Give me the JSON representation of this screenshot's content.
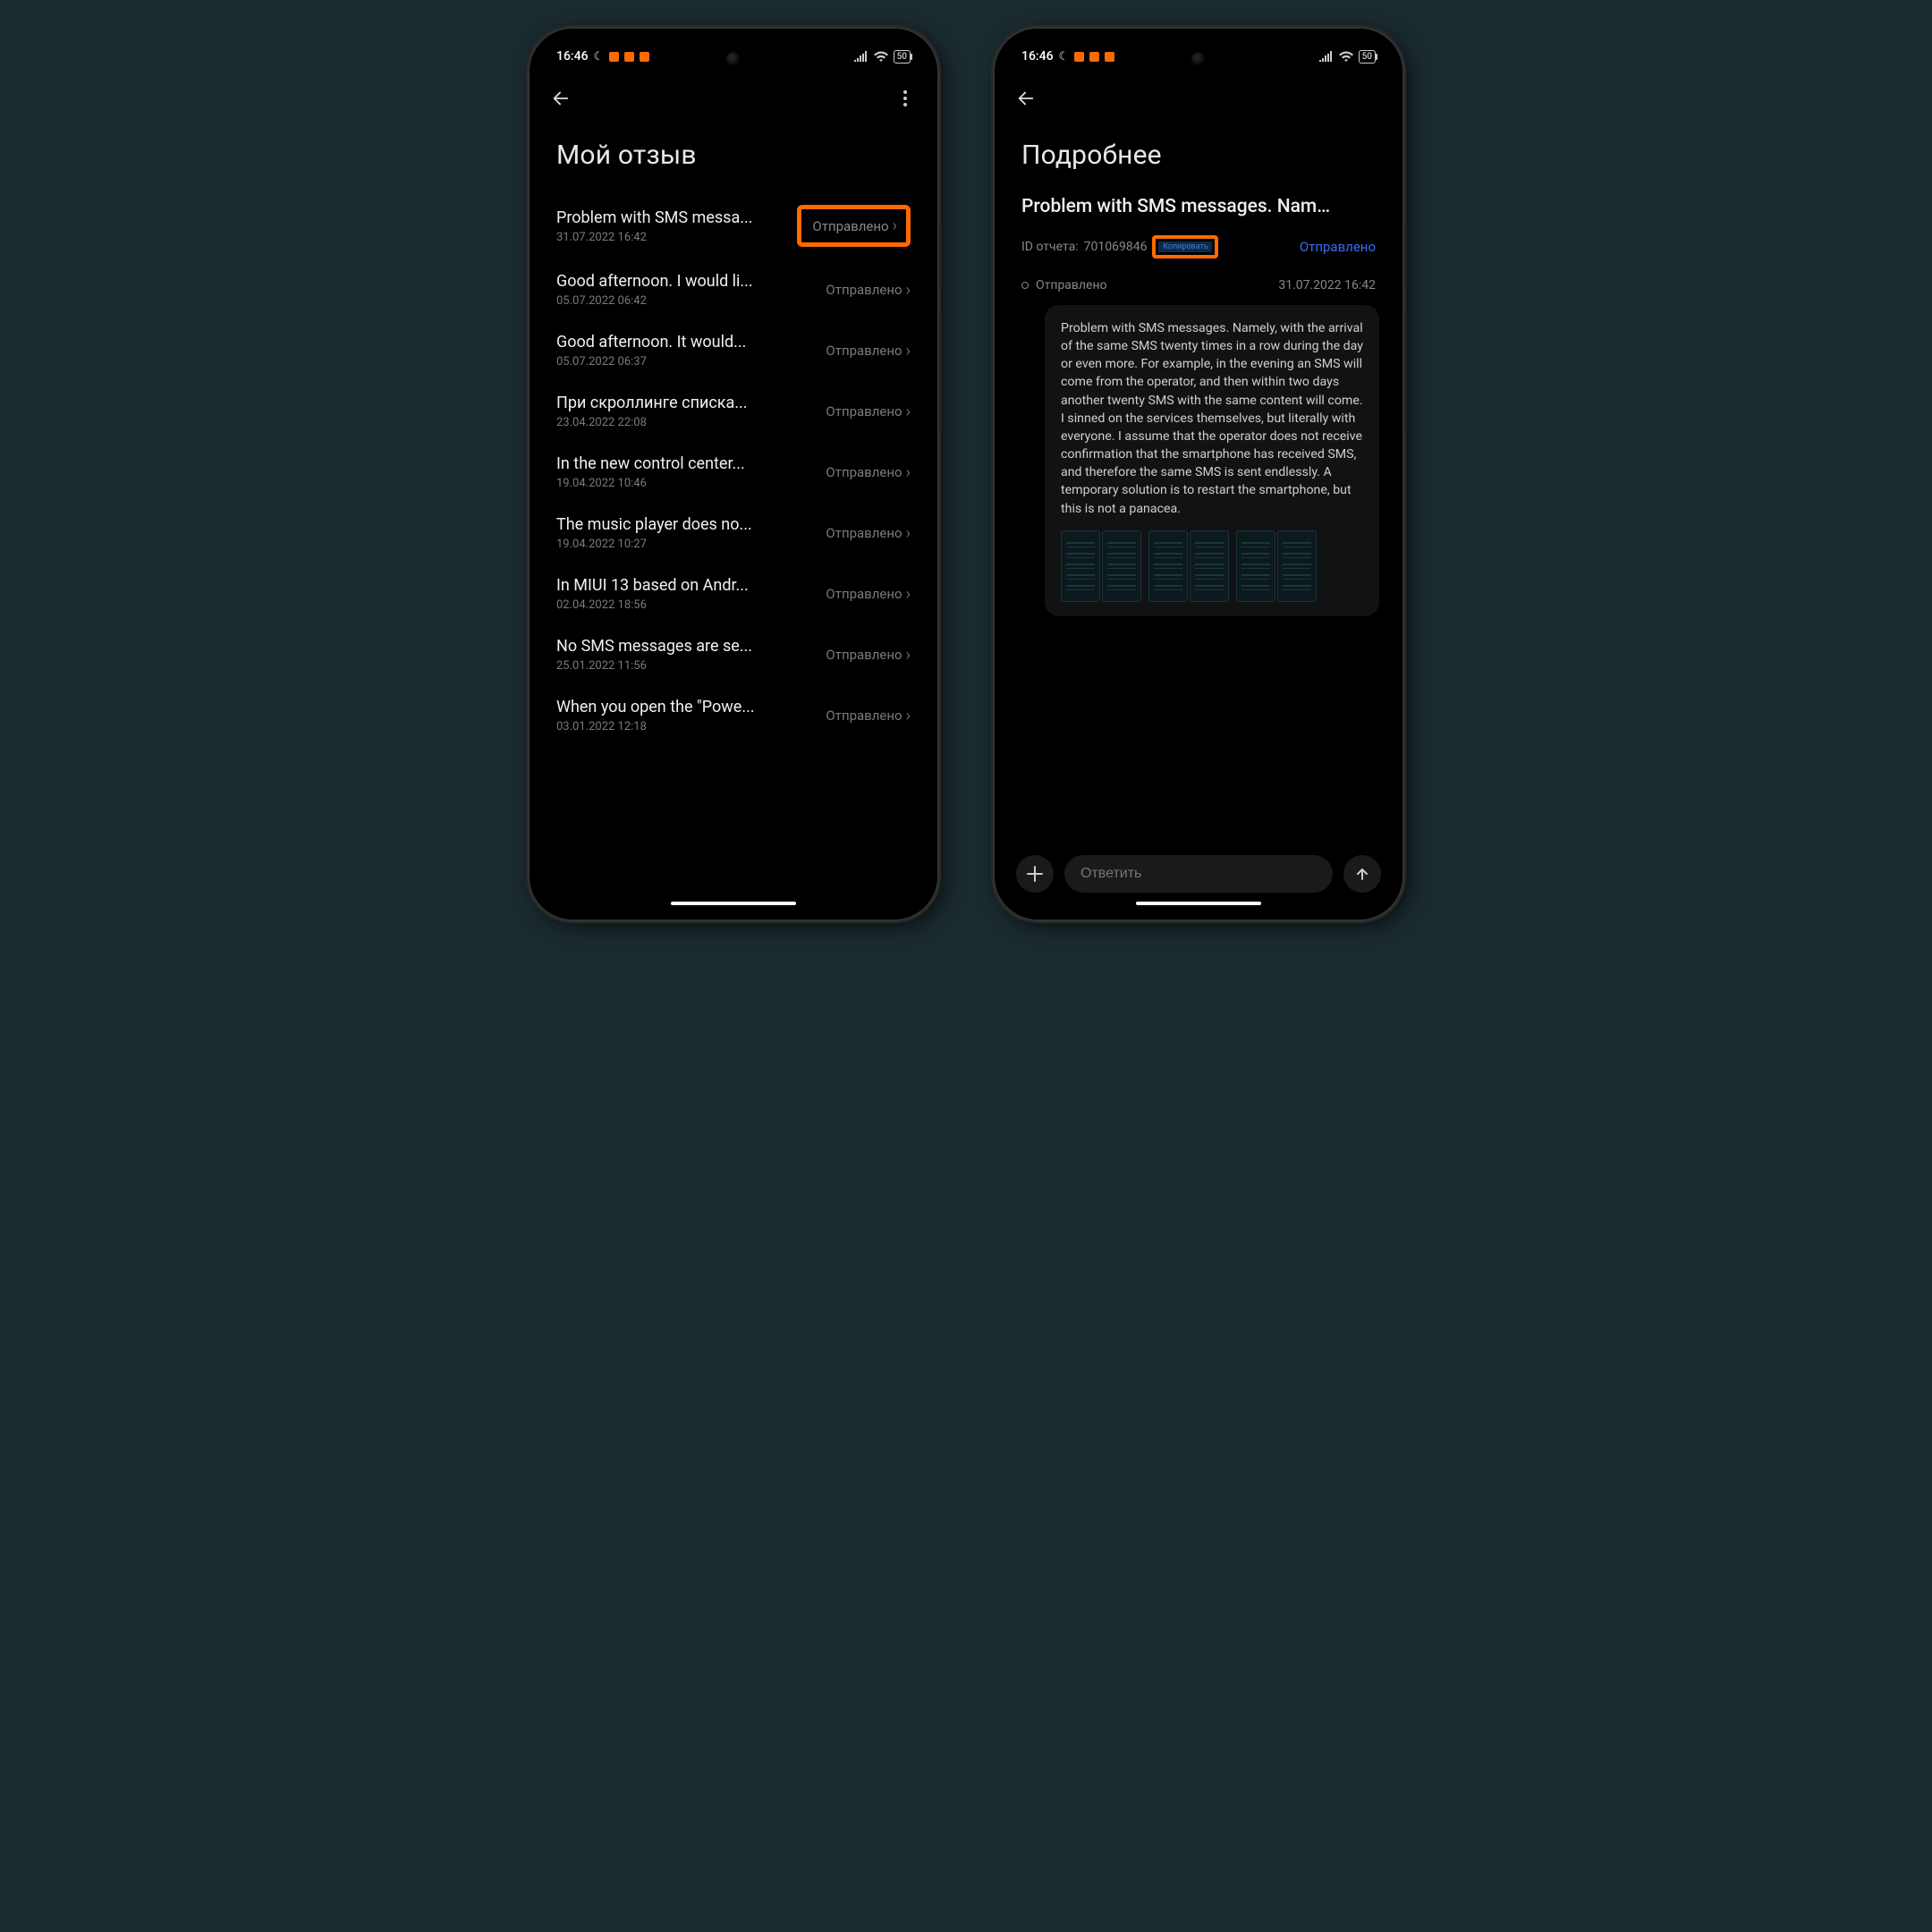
{
  "statusbar": {
    "time": "16:46",
    "battery": "50"
  },
  "left": {
    "title": "Мой отзыв",
    "status_label": "Отправлено",
    "items": [
      {
        "title": "Problem with SMS messa...",
        "date": "31.07.2022 16:42",
        "highlight": true
      },
      {
        "title": "Good afternoon. I would li...",
        "date": "05.07.2022 06:42",
        "highlight": false
      },
      {
        "title": "Good afternoon. It would...",
        "date": "05.07.2022 06:37",
        "highlight": false
      },
      {
        "title": "При скроллинге списка...",
        "date": "23.04.2022 22:08",
        "highlight": false
      },
      {
        "title": "In the new control center...",
        "date": "19.04.2022 10:46",
        "highlight": false
      },
      {
        "title": "The music player does no...",
        "date": "19.04.2022 10:27",
        "highlight": false
      },
      {
        "title": "In MIUI 13 based on Andr...",
        "date": "02.04.2022 18:56",
        "highlight": false
      },
      {
        "title": "No SMS messages are se...",
        "date": "25.01.2022 11:56",
        "highlight": false
      },
      {
        "title": "When you open the \"Powe...",
        "date": "03.01.2022 12:18",
        "highlight": false
      }
    ]
  },
  "right": {
    "title": "Подробнее",
    "subject": "Problem with SMS messages. Nam…",
    "id_label": "ID отчета:",
    "report_id": "701069846",
    "copy_label": "Копировать",
    "status": "Отправлено",
    "sent_label": "Отправлено",
    "timestamp": "31.07.2022 16:42",
    "body": "Problem with SMS messages. Namely, with the arrival of the same SMS twenty times in a row during the day or even more. For example, in the evening an SMS will come from the operator, and then within two days another twenty SMS with the same content will come. I sinned on the services themselves, but literally with everyone. I assume that the operator does not receive confirmation that the smartphone has received SMS, and therefore the same SMS is sent endlessly. A temporary solution is to restart the smartphone, but this is not a panacea.",
    "reply_placeholder": "Ответить",
    "attachment_count": 6
  }
}
